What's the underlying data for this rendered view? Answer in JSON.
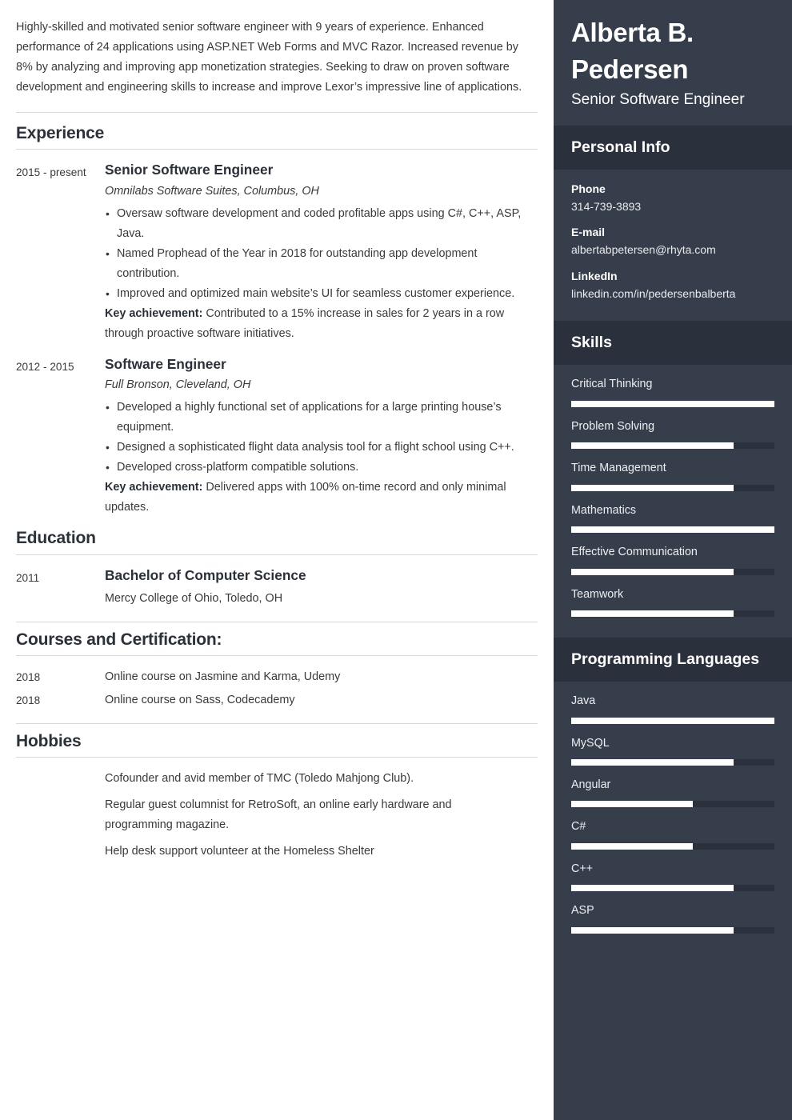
{
  "summary": {
    "text": "Highly-skilled and motivated senior software engineer with 9 years of experience. Enhanced performance of 24 applications using ASP.NET Web Forms and MVC Razor. Increased revenue by 8% by analyzing and improving app monetization strategies. Seeking to draw on proven software development and engineering skills to increase and improve Lexor’s impressive line of applications."
  },
  "sections": {
    "experience_title": "Experience",
    "education_title": "Education",
    "courses_title": "Courses and Certification:",
    "hobbies_title": "Hobbies"
  },
  "experience": [
    {
      "date": "2015 - present",
      "title": "Senior Software Engineer",
      "company": "Omnilabs Software Suites, Columbus, OH",
      "bullets": [
        "Oversaw software development and coded profitable apps using C#, C++, ASP, Java.",
        "Named Prophead of the Year in 2018 for outstanding app development contribution.",
        "Improved and optimized main website’s UI for seamless customer experience."
      ],
      "key_label": "Key achievement:",
      "key_text": " Contributed to a 15% increase in sales for 2 years in a row through proactive software initiatives."
    },
    {
      "date": "2012 - 2015",
      "title": "Software Engineer",
      "company": "Full Bronson, Cleveland, OH",
      "bullets": [
        "Developed a highly functional set of applications for a large printing house’s equipment.",
        "Designed a sophisticated flight data analysis tool for a flight school using C++.",
        "Developed cross-platform compatible solutions."
      ],
      "key_label": "Key achievement:",
      "key_text": " Delivered apps with 100% on-time record and only minimal updates."
    }
  ],
  "education": [
    {
      "date": "2011",
      "degree": "Bachelor of Computer Science",
      "school": "Mercy College of Ohio, Toledo, OH"
    }
  ],
  "courses": [
    {
      "date": "2018",
      "text": "Online course on Jasmine and Karma, Udemy"
    },
    {
      "date": "2018",
      "text": "Online course on Sass, Codecademy"
    }
  ],
  "hobbies": [
    "Cofounder and avid member of TMC (Toledo Mahjong Club).",
    "Regular guest columnist for RetroSoft, an online early hardware and programming magazine.",
    "Help desk support volunteer at the Homeless Shelter"
  ],
  "sidebar": {
    "name": "Alberta B. Pedersen",
    "role": "Senior Software Engineer",
    "personal_info_title": "Personal Info",
    "personal_info": [
      {
        "label": "Phone",
        "value": "314-739-3893"
      },
      {
        "label": "E-mail",
        "value": "albertabpetersen@rhyta.com"
      },
      {
        "label": "LinkedIn",
        "value": "linkedin.com/in/pedersenbalberta"
      }
    ],
    "skills_title": "Skills",
    "skills": [
      {
        "label": "Critical Thinking",
        "level": 100
      },
      {
        "label": "Problem Solving",
        "level": 80
      },
      {
        "label": "Time Management",
        "level": 80
      },
      {
        "label": "Mathematics",
        "level": 100
      },
      {
        "label": "Effective Communication",
        "level": 80
      },
      {
        "label": "Teamwork",
        "level": 80
      }
    ],
    "languages_title": "Programming Languages",
    "languages": [
      {
        "label": "Java",
        "level": 100
      },
      {
        "label": "MySQL",
        "level": 80
      },
      {
        "label": "Angular",
        "level": 60
      },
      {
        "label": "C#",
        "level": 60
      },
      {
        "label": "C++",
        "level": 80
      },
      {
        "label": "ASP",
        "level": 80
      }
    ]
  },
  "colors": {
    "sidebar_bg": "#373e4b",
    "sidebar_band_bg": "#2b313c",
    "bar_fill": "#ffffff",
    "bar_track": "#2b313c",
    "heading": "#2b3039",
    "body_text": "#3a3a3a"
  }
}
